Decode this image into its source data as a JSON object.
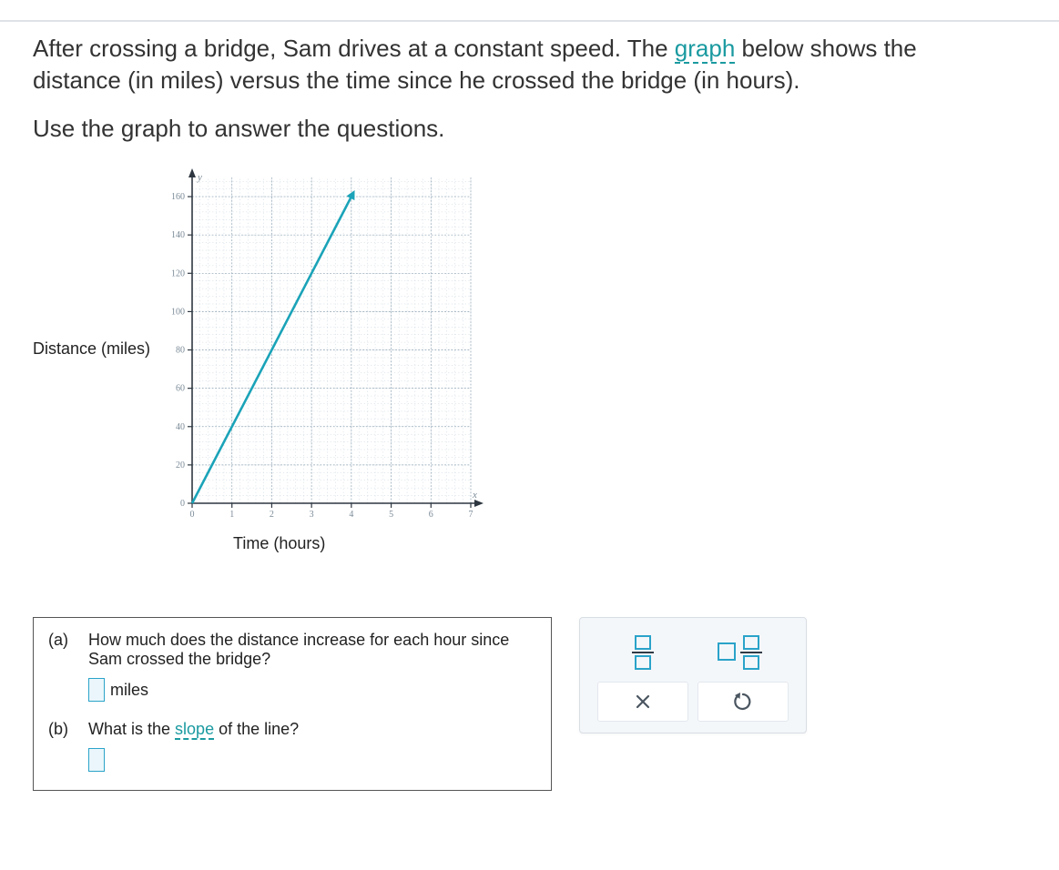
{
  "problem": {
    "p1_pre": "After crossing a bridge, Sam drives at a constant speed. The ",
    "p1_link": "graph",
    "p1_post": " below shows the distance (in miles) versus the time since he crossed the bridge (in hours).",
    "p2": "Use the graph to answer the questions."
  },
  "chart_data": {
    "type": "line",
    "title": "",
    "xlabel": "Time (hours)",
    "ylabel": "Distance (miles)",
    "xlim": [
      0,
      7
    ],
    "ylim": [
      0,
      170
    ],
    "x_ticks": [
      0,
      1,
      2,
      3,
      4,
      5,
      6,
      7
    ],
    "y_ticks": [
      0,
      20,
      40,
      60,
      80,
      100,
      120,
      140,
      160
    ],
    "y_tick_labels_show_zero": true,
    "grid_major_x_step": 1,
    "grid_major_y_step": 20,
    "grid_minor_divisions": 5,
    "series": [
      {
        "name": "distance",
        "color": "#1aa3b8",
        "arrow_end": true,
        "points": [
          {
            "x": 0,
            "y": 0
          },
          {
            "x": 4,
            "y": 160
          }
        ]
      }
    ],
    "x_axis_letter": "x",
    "y_axis_letter": "y"
  },
  "questions": {
    "a": {
      "label": "(a)",
      "text": "How much does the distance increase for each hour since Sam crossed the bridge?",
      "unit": "miles"
    },
    "b": {
      "label": "(b)",
      "text_pre": "What is the ",
      "text_link": "slope",
      "text_post": " of the line?"
    }
  },
  "tools": {
    "fraction_name": "fraction-tool",
    "mixed_name": "mixed-number-tool",
    "clear_name": "clear-tool",
    "undo_name": "undo-tool"
  },
  "colors": {
    "accent": "#1aa3b8",
    "link": "#1a9aa0"
  }
}
